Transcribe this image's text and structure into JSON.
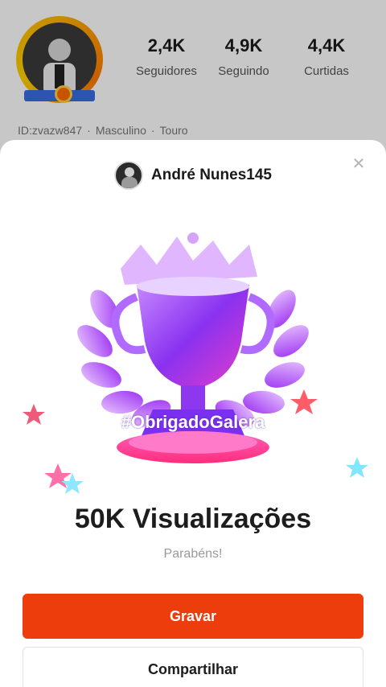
{
  "profile": {
    "stats": [
      {
        "value": "2,4K",
        "label": "Seguidores"
      },
      {
        "value": "4,9K",
        "label": "Seguindo"
      },
      {
        "value": "4,4K",
        "label": "Curtidas"
      }
    ],
    "id": "ID:zvazw847",
    "gender": "Masculino",
    "sign": "Touro"
  },
  "sheet": {
    "username": "André Nunes145",
    "close_icon": "close-icon",
    "hashtag": "#ObrigadoGalera",
    "title": "50K Visualizações",
    "subtitle": "Parabéns!",
    "primary_button": "Gravar",
    "secondary_button": "Compartilhar"
  },
  "colors": {
    "accent": "#ee3d0c",
    "trophy_purple": "#9b2bf0",
    "trophy_pink": "#ff3fa0"
  }
}
